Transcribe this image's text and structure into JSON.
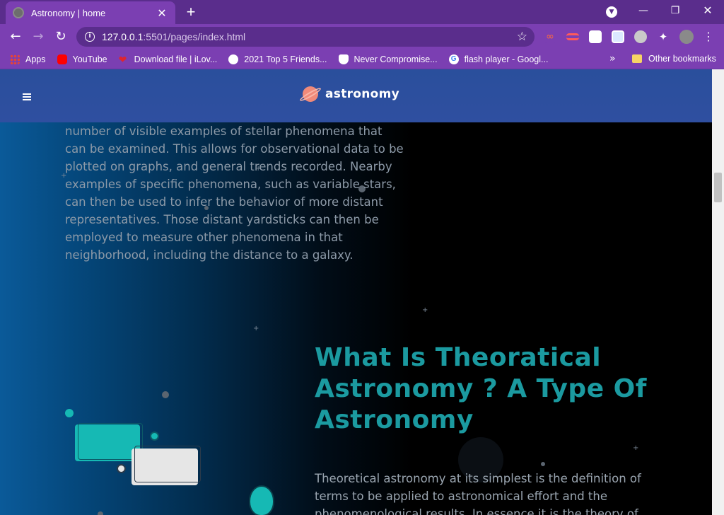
{
  "browser": {
    "tab_title": "Astronomy | home",
    "tab_close": "✕",
    "new_tab": "+",
    "url_host": "127.0.0.1",
    "url_path": ":5501/pages/index.html",
    "window_controls": {
      "minimize": "—",
      "maximize": "❐",
      "close": "✕"
    },
    "nav": {
      "back": "←",
      "forward": "→",
      "reload": "↻"
    },
    "bookmarks": [
      {
        "label": "Apps",
        "icon": "apps-grid-icon",
        "color": "#e94335"
      },
      {
        "label": "YouTube",
        "icon": "youtube-icon",
        "color": "#ff0000"
      },
      {
        "label": "Download file | iLov...",
        "icon": "heart-icon",
        "color": "#e0252e"
      },
      {
        "label": "2021 Top 5 Friends...",
        "icon": "globe-icon",
        "color": "#ffffff"
      },
      {
        "label": "Never Compromise...",
        "icon": "shield-icon",
        "color": "#ffffff"
      },
      {
        "label": "flash player - Googl...",
        "icon": "google-icon",
        "color": "#ffffff"
      }
    ],
    "bookmarks_more": "»",
    "other_bookmarks": "Other bookmarks"
  },
  "site": {
    "logo_text": "astronomy",
    "accent_color": "#1b9aa0",
    "intro_paragraph": "number of visible examples of stellar phenomena that can be examined. This allows for observational data to be plotted on graphs, and general trends recorded. Nearby examples of specific phenomena, such as variable stars, can then be used to infer the behavior of more distant representatives. Those distant yardsticks can then be employed to measure other phenomena in that neighborhood, including the distance to a galaxy.",
    "section_title": "What Is Theoratical Astronomy ? A Type Of Astronomy",
    "section_body": "Theoretical astronomy at its simplest is the definition of terms to be applied to astronomical effort and the phenomenological results. In essence it is the theory of the"
  }
}
